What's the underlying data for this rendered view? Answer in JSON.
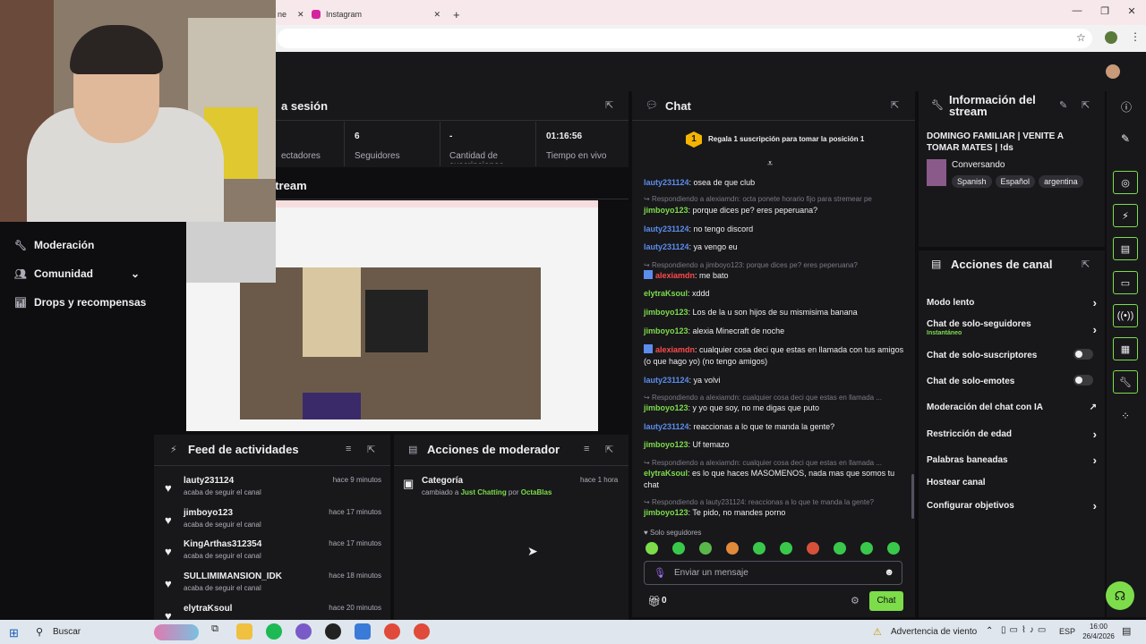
{
  "browser": {
    "tabs": [
      {
        "label": "ne"
      },
      {
        "label": "Instagram"
      }
    ],
    "new_tab": "+"
  },
  "nav": {
    "items": [
      {
        "label": "Moderación"
      },
      {
        "label": "Comunidad"
      },
      {
        "label": "Drops y recompensas"
      }
    ]
  },
  "session": {
    "title": "a sesión",
    "stats": [
      {
        "value": "",
        "label": "ectadores"
      },
      {
        "value": "6",
        "label": "Seguidores"
      },
      {
        "value": "-",
        "label": "Cantidad de suscripciones"
      },
      {
        "value": "01:16:56",
        "label": "Tiempo en vivo"
      }
    ]
  },
  "stream_preview": {
    "title": "stream"
  },
  "activity": {
    "title": "Feed de actividades",
    "items": [
      {
        "name": "lauty231124",
        "sub": "acaba de seguir el canal",
        "time": "hace 9 minutos"
      },
      {
        "name": "jimboyo123",
        "sub": "acaba de seguir el canal",
        "time": "hace 17 minutos"
      },
      {
        "name": "KingArthas312354",
        "sub": "acaba de seguir el canal",
        "time": "hace 17 minutos"
      },
      {
        "name": "SULLIMIMANSION_IDK",
        "sub": "acaba de seguir el canal",
        "time": "hace 18 minutos"
      },
      {
        "name": "elytraKsoul",
        "sub": "",
        "time": "hace 20 minutos"
      }
    ]
  },
  "modactions": {
    "title": "Acciones de moderador",
    "item": {
      "title": "Categoría",
      "time": "hace 1 hora",
      "pre": "cambiado a ",
      "category": "Just Chatting",
      "by": " por ",
      "user": "OctaBlas"
    }
  },
  "chat": {
    "title": "Chat",
    "gift_rank": "1",
    "gift_text": "Regala 1 suscripción para tomar la posición 1",
    "messages": [
      {
        "user": "lauty231124",
        "color": "blue",
        "text": ": osea de que club"
      },
      {
        "reply": "Respondiendo a alexiamdn: octa ponete horario fijo para stremear pe"
      },
      {
        "user": "jimboyo123",
        "color": "green",
        "text": ": porque dices pe? eres peperuana?"
      },
      {
        "user": "lauty231124",
        "color": "blue",
        "text": ": no tengo discord"
      },
      {
        "user": "lauty231124",
        "color": "blue",
        "text": ": ya vengo eu"
      },
      {
        "reply": "Respondiendo a jimboyo123: porque dices pe? eres peperuana?"
      },
      {
        "user": "alexiamdn",
        "color": "red",
        "text": ": me bato"
      },
      {
        "user": "elytraKsoul",
        "color": "green",
        "text": ": xddd"
      },
      {
        "user": "jimboyo123",
        "color": "green",
        "text": ": Los de la u son hijos de su mismisima banana"
      },
      {
        "user": "jimboyo123",
        "color": "green",
        "text": ": alexia Minecraft de noche"
      },
      {
        "user": "alexiamdn",
        "color": "red",
        "text": ": cualquier cosa deci que estas en llamada con tus amigos (o que hago yo) (no tengo amigos)"
      },
      {
        "user": "lauty231124",
        "color": "blue",
        "text": ": ya volvi"
      },
      {
        "reply": "Respondiendo a alexiamdn: cualquier cosa deci que estas en llamada ..."
      },
      {
        "user": "jimboyo123",
        "color": "green",
        "text": ": y yo que soy, no me digas que puto"
      },
      {
        "user": "lauty231124",
        "color": "blue",
        "text": ": reaccionas a lo que te manda la gente?"
      },
      {
        "user": "jimboyo123",
        "color": "green",
        "text": ": Uf temazo"
      },
      {
        "reply": "Respondiendo a alexiamdn: cualquier cosa deci que estas en llamada ..."
      },
      {
        "user": "elytraKsoul",
        "color": "green",
        "text": ": es lo que haces MASOMENOS, nada mas que somos tu chat"
      },
      {
        "reply": "Respondiendo a lauty231124: reaccionas a lo que te manda la gente?"
      },
      {
        "user": "jimboyo123",
        "color": "green",
        "text": ": Te pido, no mandes porno"
      }
    ],
    "followers_only": "Solo seguidores",
    "input_placeholder": "Enviar un mensaje",
    "points": "0",
    "send_label": "Chat"
  },
  "stream_info": {
    "title": "Información del stream",
    "stream_title": "DOMINGO FAMILIAR | VENITE A TOMAR MATES | !ds",
    "category": "Conversando",
    "tags": [
      "Spanish",
      "Español",
      "argentina"
    ]
  },
  "channel_actions": {
    "title": "Acciones de canal",
    "rows": [
      {
        "label": "Modo lento",
        "kind": "chevron"
      },
      {
        "label": "Chat de solo-seguidores",
        "sub": "Instantáneo",
        "kind": "chevron"
      },
      {
        "label": "Chat de solo-suscriptores",
        "kind": "toggle"
      },
      {
        "label": "Chat de solo-emotes",
        "kind": "toggle"
      },
      {
        "label": "Moderación del chat con IA",
        "kind": "external"
      },
      {
        "label": "Restricción de edad",
        "kind": "chevron"
      },
      {
        "label": "Palabras baneadas",
        "kind": "chevron"
      },
      {
        "label": "Hostear canal",
        "kind": "none"
      },
      {
        "label": "Configurar objetivos",
        "kind": "chevron"
      }
    ]
  },
  "taskbar": {
    "search": "Buscar",
    "weather": "Advertencia de viento",
    "lang": "ESP",
    "time": "16:00",
    "date": "26/4/2026"
  },
  "colors": {
    "accent_green": "#7ddc4a",
    "user_blue": "#5c8ded",
    "user_red": "#ff4a4a",
    "panel": "#18181b",
    "bg": "#0e0e10"
  }
}
